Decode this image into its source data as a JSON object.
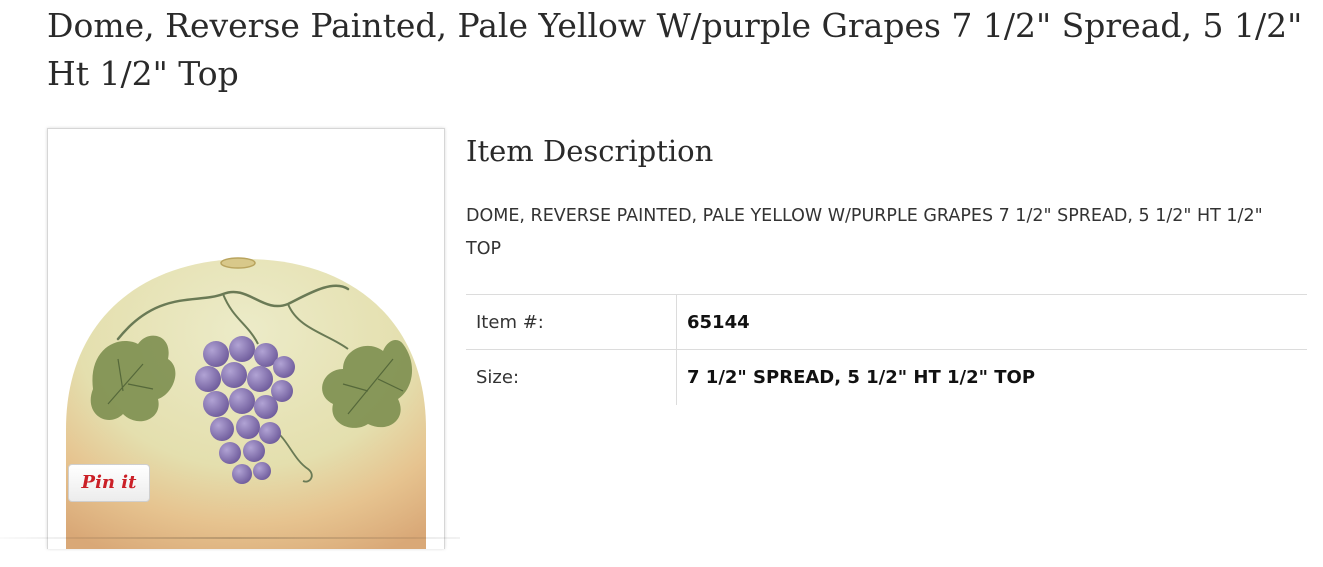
{
  "product": {
    "title": "Dome, Reverse Painted, Pale Yellow W/purple Grapes 7 1/2\" Spread, 5 1/2\" Ht 1/2\" Top",
    "pin_label": "Pin it"
  },
  "description": {
    "heading": "Item Description",
    "text": "DOME, REVERSE PAINTED, PALE YELLOW W/PURPLE GRAPES 7 1/2\" SPREAD, 5 1/2\" HT 1/2\" TOP"
  },
  "specs": [
    {
      "label": "Item #:",
      "value": "65144"
    },
    {
      "label": "Size:",
      "value": "7 1/2\" SPREAD, 5 1/2\" HT 1/2\" TOP"
    }
  ],
  "colors": {
    "glass_yellow": "#e6e2b6",
    "glass_amber": "#e2b27e",
    "grape_purple": "#8a76b5",
    "leaf_green": "#7a8c4c",
    "pinterest_red": "#cb2027"
  }
}
